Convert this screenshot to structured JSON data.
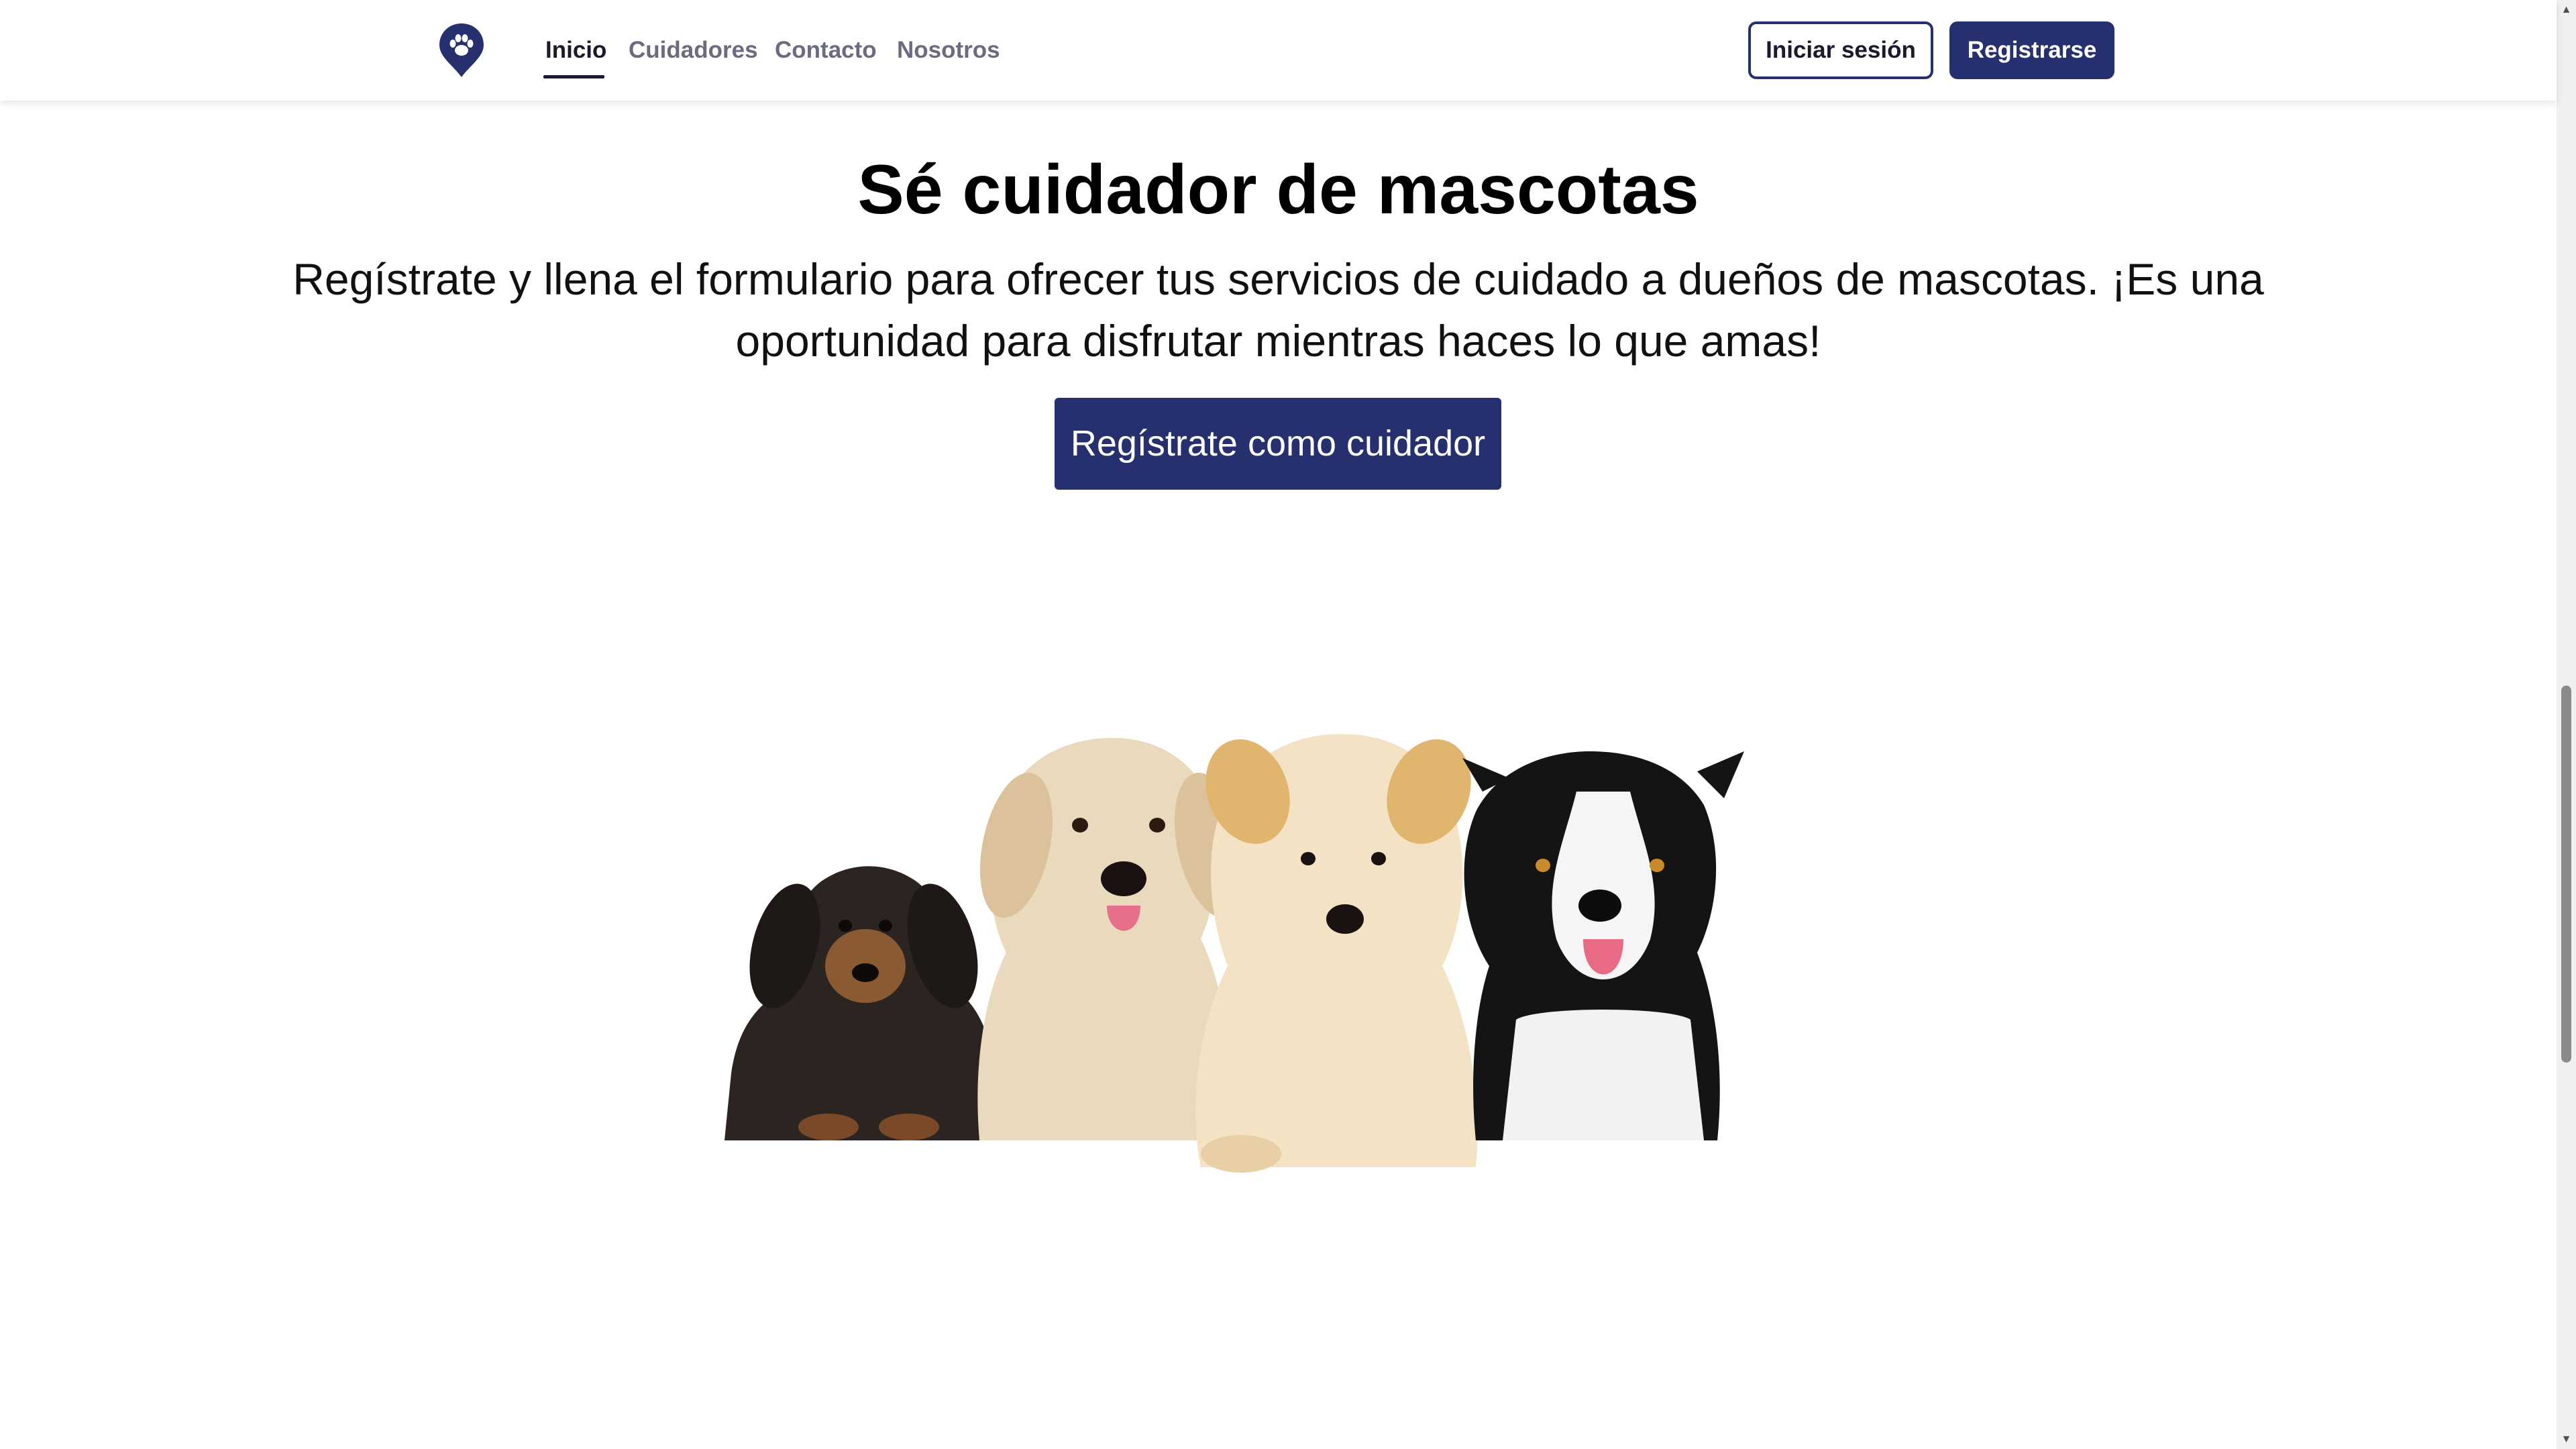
{
  "nav": {
    "logo_icon": "paw-location-pin-icon",
    "links": [
      {
        "label": "Inicio",
        "active": true
      },
      {
        "label": "Cuidadores",
        "active": false
      },
      {
        "label": "Contacto",
        "active": false
      },
      {
        "label": "Nosotros",
        "active": false
      }
    ],
    "login_label": "Iniciar sesión",
    "register_label": "Registrarse"
  },
  "hero": {
    "title": "Sé cuidador de mascotas",
    "description": "Regístrate y llena el formulario para ofrecer tus servicios de cuidado a dueños de mascotas. ¡Es una oportunidad para disfrutar mientras haces lo que amas!",
    "cta_label": "Regístrate como cuidador"
  },
  "image": {
    "subject": "four-dogs-group-photo"
  },
  "colors": {
    "primary": "#26306e",
    "text_dark": "#1a1a2e",
    "nav_inactive": "#6b6b80",
    "background": "#ffffff"
  }
}
